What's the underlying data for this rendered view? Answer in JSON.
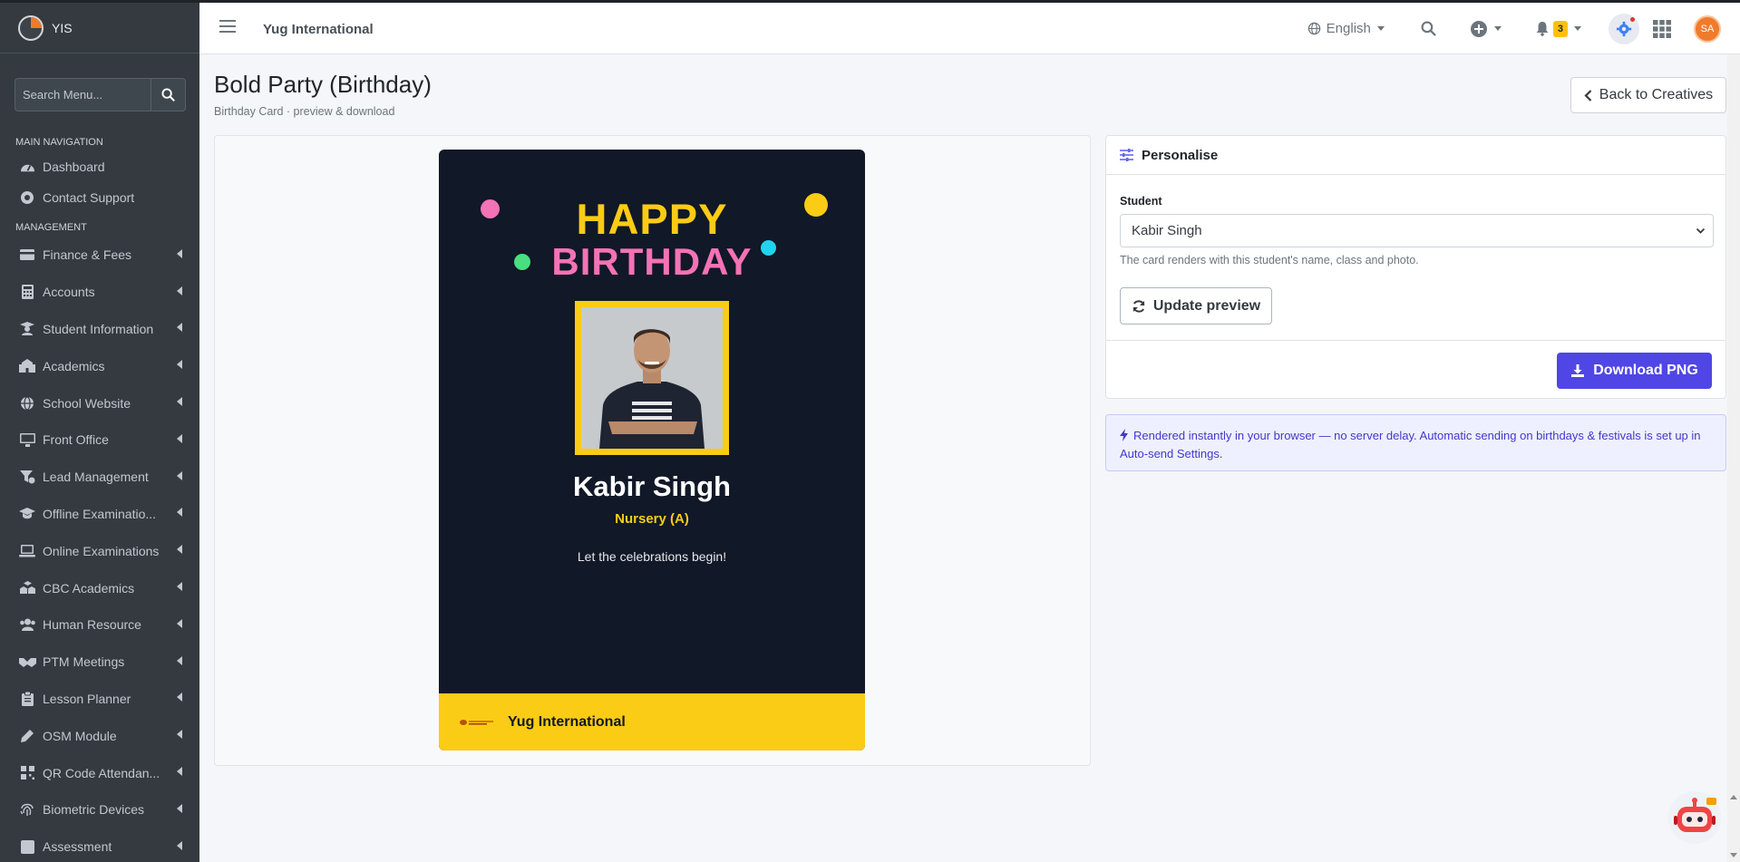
{
  "app": {
    "brand": "YIS",
    "org_title": "Yug International"
  },
  "sidebar": {
    "search_placeholder": "Search Menu...",
    "sections": [
      {
        "header": "MAIN NAVIGATION",
        "items": [
          {
            "label": "Dashboard",
            "icon": "dashboard-icon",
            "has_children": false
          },
          {
            "label": "Contact Support",
            "icon": "support-icon",
            "has_children": false
          }
        ]
      },
      {
        "header": "MANAGEMENT",
        "items": [
          {
            "label": "Finance & Fees",
            "icon": "finance-icon",
            "has_children": true
          },
          {
            "label": "Accounts",
            "icon": "calculator-icon",
            "has_children": true
          },
          {
            "label": "Student Information",
            "icon": "student-icon",
            "has_children": true
          },
          {
            "label": "Academics",
            "icon": "school-icon",
            "has_children": true
          },
          {
            "label": "School Website",
            "icon": "globe-icon",
            "has_children": true
          },
          {
            "label": "Front Office",
            "icon": "desktop-icon",
            "has_children": true
          },
          {
            "label": "Lead Management",
            "icon": "funnel-icon",
            "has_children": true
          },
          {
            "label": "Offline Examinatio...",
            "icon": "graduation-cap-icon",
            "has_children": true
          },
          {
            "label": "Online Examinations",
            "icon": "laptop-icon",
            "has_children": true
          },
          {
            "label": "CBC Academics",
            "icon": "cubes-icon",
            "has_children": true
          },
          {
            "label": "Human Resource",
            "icon": "users-icon",
            "has_children": true
          },
          {
            "label": "PTM Meetings",
            "icon": "handshake-icon",
            "has_children": true
          },
          {
            "label": "Lesson Planner",
            "icon": "clipboard-icon",
            "has_children": true
          },
          {
            "label": "OSM Module",
            "icon": "pen-icon",
            "has_children": true
          },
          {
            "label": "QR Code Attendan...",
            "icon": "qrcode-icon",
            "has_children": true
          },
          {
            "label": "Biometric Devices",
            "icon": "fingerprint-icon",
            "has_children": true
          },
          {
            "label": "Assessment",
            "icon": "assessment-icon",
            "has_children": true
          }
        ]
      }
    ]
  },
  "topbar": {
    "language": "English",
    "notification_count": "3",
    "avatar_initials": "SA"
  },
  "page": {
    "title": "Bold Party (Birthday)",
    "subtitle": "Birthday Card · preview & download",
    "back_label": "Back to Creatives"
  },
  "card": {
    "line1": "HAPPY",
    "line2": "BIRTHDAY",
    "student_name": "Kabir Singh",
    "student_class": "Nursery (A)",
    "message": "Let the celebrations begin!",
    "footer_name": "Yug International",
    "colors": {
      "background": "#111827",
      "accent_yellow": "#facc15",
      "accent_pink": "#f472b6",
      "confetti_green": "#4ade80",
      "confetti_cyan": "#22d3ee"
    }
  },
  "personalise": {
    "title": "Personalise",
    "student_label": "Student",
    "student_value": "Kabir Singh",
    "help_text": "The card renders with this student's name, class and photo.",
    "update_label": "Update preview",
    "download_label": "Download PNG"
  },
  "info": {
    "text": "Rendered instantly in your browser — no server delay. Automatic sending on birthdays & festivals is set up in Auto-send Settings."
  },
  "theme": {
    "primary": "#4f46e5",
    "sidebar_bg": "#343a40",
    "orange": "#f07b2c"
  }
}
